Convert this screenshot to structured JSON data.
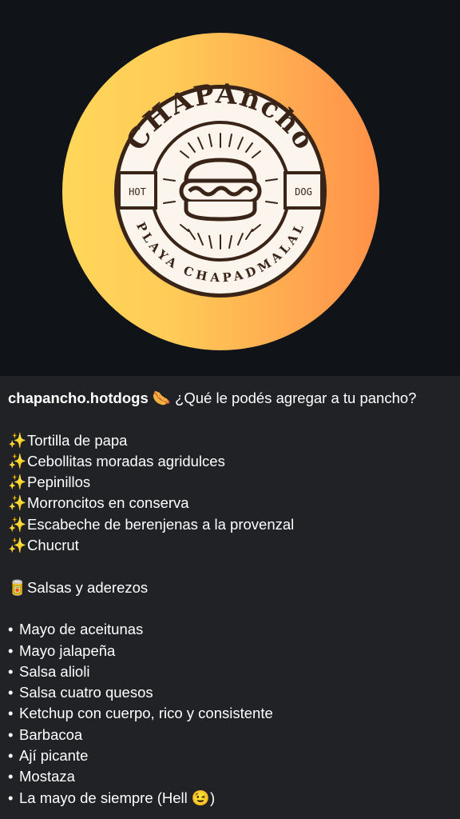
{
  "logo": {
    "brand_text": "CHAPAncho",
    "left_text": "HOT",
    "right_text": "DOG",
    "bottom_text": "PLAYA CHAPADMALAL"
  },
  "caption": {
    "username": "chapancho.hotdogs",
    "username_emoji": "🌭",
    "headline": "¿Qué le podés agregar a tu pancho?",
    "sparkle_icon": "✨",
    "toppings": [
      "Tortilla de papa",
      "Cebollitas moradas agridulces",
      "Pepinillos",
      "Morroncitos en conserva",
      "Escabeche de berenjenas a la provenzal",
      "Chucrut"
    ],
    "sauces_icon": "🥫",
    "sauces_title": "Salsas y aderezos",
    "bullet": "•",
    "sauces": [
      "Mayo de aceitunas",
      "Mayo jalapeña",
      "Salsa alioli",
      "Salsa cuatro quesos",
      "Ketchup con cuerpo, rico y consistente",
      "Barbacoa",
      "Ají picante",
      "Mostaza",
      "La mayo de siempre (Hell 😉)"
    ]
  },
  "colors": {
    "page_bg": "#101318",
    "caption_bg": "#202226",
    "badge_brown": "#3a2418",
    "badge_cream": "#fbf5ee",
    "gradient_start": "#ffd75a",
    "gradient_end": "#ff9148"
  }
}
